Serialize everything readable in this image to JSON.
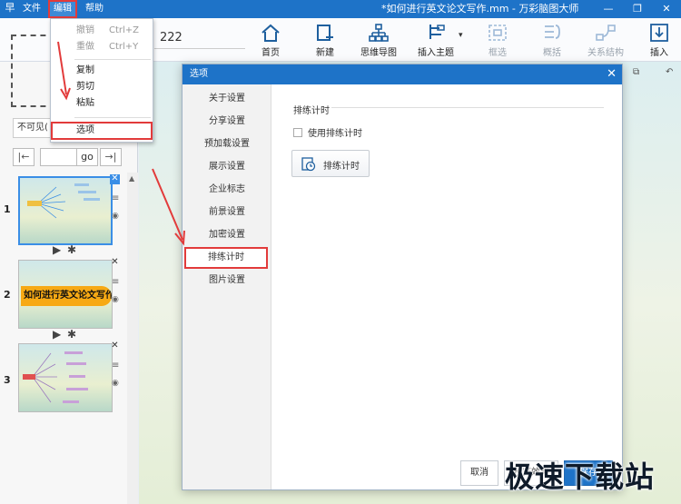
{
  "app": {
    "logo_glyph": "早",
    "menus": [
      "文件",
      "编辑",
      "帮助"
    ],
    "doc_title": "*如何进行英文论文写作.mm - 万彩脑图大师",
    "window_controls": [
      "—",
      "❐",
      "✕"
    ]
  },
  "ribbon": {
    "font_size_value": "222",
    "buttons": [
      {
        "label": "首页",
        "icon": "home-icon",
        "enabled": true
      },
      {
        "label": "新建",
        "icon": "new-icon",
        "enabled": true
      },
      {
        "label": "思维导图",
        "icon": "mindmap-icon",
        "enabled": true
      },
      {
        "label": "插入主题",
        "icon": "insert-topic-icon",
        "enabled": true
      },
      {
        "label": "框选",
        "icon": "select-frame-icon",
        "enabled": false
      },
      {
        "label": "概括",
        "icon": "summary-icon",
        "enabled": false
      },
      {
        "label": "关系结构",
        "icon": "relation-icon",
        "enabled": false
      },
      {
        "label": "插入",
        "icon": "insert-icon",
        "enabled": true
      }
    ],
    "insert_topic_caret": "▾"
  },
  "edit_menu": {
    "items": [
      {
        "label": "撤销",
        "shortcut": "Ctrl+Z",
        "enabled": false
      },
      {
        "label": "重做",
        "shortcut": "Ctrl+Y",
        "enabled": false
      },
      {
        "label": "复制",
        "shortcut": "",
        "enabled": true
      },
      {
        "label": "剪切",
        "shortcut": "",
        "enabled": true
      },
      {
        "label": "粘贴",
        "shortcut": "",
        "enabled": true
      },
      {
        "label": "选项",
        "shortcut": "",
        "enabled": true,
        "highlighted": true
      }
    ]
  },
  "left_panel": {
    "visibility_text": "不可见(",
    "nav_first": "|←",
    "nav_go": "go",
    "nav_last": "→|",
    "scroll_up": "▲",
    "slides": [
      {
        "number": "1",
        "selected": true,
        "title": ""
      },
      {
        "number": "2",
        "selected": false,
        "title": "如何进行英文论文写作"
      },
      {
        "number": "3",
        "selected": false,
        "title": ""
      }
    ],
    "slide_close_glyph": "✕",
    "slide_menu_glyph": "≡",
    "slide_eye_glyph": "◉",
    "play_glyph": "▶",
    "settings_glyph": "✱"
  },
  "canvas_tools": [
    "⧉",
    "↶"
  ],
  "dialog": {
    "title": "选项",
    "close_glyph": "✕",
    "nav_items": [
      "关于设置",
      "分享设置",
      "预加载设置",
      "展示设置",
      "企业标志",
      "前景设置",
      "加密设置",
      "排练计时",
      "图片设置"
    ],
    "active_nav": "排练计时",
    "section_title": "排练计时",
    "checkbox_label": "使用排练计时",
    "checkbox_checked": false,
    "timer_button_label": "排练计时",
    "footer": {
      "cancel": "取消",
      "preview": "预览效果",
      "save": "保存"
    }
  },
  "watermark": "极速下载站",
  "colors": {
    "titlebar": "#1e73c8",
    "highlight": "#e23b3b",
    "primary": "#1e73c8"
  }
}
